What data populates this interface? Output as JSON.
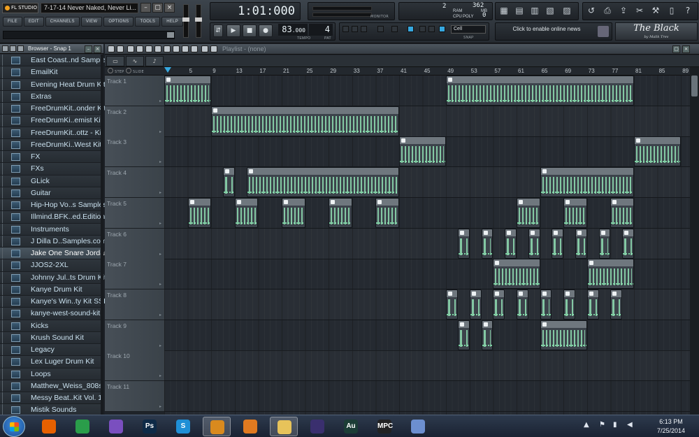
{
  "window": {
    "app_logo": "FL STUDIO",
    "song_title": "7-17-14 Never Naked, Never Li..."
  },
  "menu": [
    "FILE",
    "EDIT",
    "CHANNELS",
    "VIEW",
    "OPTIONS",
    "TOOLS",
    "HELP"
  ],
  "transport": {
    "song_position": "1:01:000",
    "tempo_main": "83",
    "tempo_frac": ".000",
    "tempo_label": "TEMPO",
    "pattern": "4",
    "pattern_label": "PAT"
  },
  "monitor": {
    "label": "MONITOR"
  },
  "performance": {
    "ram_value": "2",
    "ram_label": "RAM",
    "mb_value": "362",
    "mb_label": "MB",
    "cpu_label": "CPU",
    "poly_label": "POLY",
    "poly_value": "0"
  },
  "snap": {
    "value": "Cell",
    "label": "SNAP"
  },
  "news": {
    "text": "Click to enable online news"
  },
  "brand": {
    "name": "The Black",
    "sub": "by Malik Trev"
  },
  "browser": {
    "title": "Browser - Snap 1",
    "selected_index": 16,
    "folders": [
      "East Coast..nd Samples",
      "EmailKit",
      "Evening Heat Drum Kit",
      "Extras",
      "FreeDrumKit..onder Kit",
      "FreeDrumKi..emist  Kit",
      "FreeDrumKit..ottz - Kit",
      "FreeDrumKi..West Kit",
      "FX",
      "FXs",
      "GLick",
      "Guitar",
      "Hip-Hop Vo..s Samples",
      "Illmind.BFK..ed.Edition",
      "Instruments",
      "J Dilla D..Samples.com",
      "Jake One Snare Jordan",
      "JJOS2-2XL",
      "Johnny Jul..ts Drum Kit",
      "Kanye Drum Kit",
      "Kanye's Win..ty Kit SSL",
      "kanye-west-sound-kit",
      "Kicks",
      "Krush Sound Kit",
      "Legacy",
      "Lex Luger Drum Kit",
      "Loops",
      "Matthew_Weiss_808s",
      "Messy Beat..Kit Vol. 1",
      "Mistik Sounds"
    ]
  },
  "playlist": {
    "title": "Playlist - (none)",
    "step_label": "STEP",
    "slide_label": "SLIDE",
    "ruler_ticks": [
      "5",
      "9",
      "13",
      "17",
      "21",
      "25",
      "29",
      "33",
      "37",
      "41",
      "45",
      "49",
      "53",
      "57",
      "61",
      "65",
      "69",
      "73",
      "77",
      "81",
      "85",
      "89"
    ],
    "tracks": [
      "Track 1",
      "Track 2",
      "Track 3",
      "Track 4",
      "Track 5",
      "Track 6",
      "Track 7",
      "Track 8",
      "Track 9",
      "Track 10",
      "Track 11"
    ],
    "clips": [
      {
        "track": 0,
        "bars": [
          1,
          9
        ]
      },
      {
        "track": 0,
        "bars": [
          49,
          81
        ]
      },
      {
        "track": 1,
        "bars": [
          9,
          41
        ]
      },
      {
        "track": 2,
        "bars": [
          41,
          49
        ]
      },
      {
        "track": 2,
        "bars": [
          81,
          89
        ]
      },
      {
        "track": 3,
        "bars": [
          11,
          13
        ]
      },
      {
        "track": 3,
        "bars": [
          15,
          41
        ]
      },
      {
        "track": 3,
        "bars": [
          65,
          81
        ]
      },
      {
        "track": 4,
        "bars": [
          5,
          9
        ]
      },
      {
        "track": 4,
        "bars": [
          13,
          17
        ]
      },
      {
        "track": 4,
        "bars": [
          21,
          25
        ]
      },
      {
        "track": 4,
        "bars": [
          29,
          33
        ]
      },
      {
        "track": 4,
        "bars": [
          37,
          41
        ]
      },
      {
        "track": 4,
        "bars": [
          61,
          65
        ]
      },
      {
        "track": 4,
        "bars": [
          69,
          73
        ]
      },
      {
        "track": 4,
        "bars": [
          77,
          81
        ]
      },
      {
        "track": 5,
        "bars": [
          51,
          53
        ]
      },
      {
        "track": 5,
        "bars": [
          55,
          57
        ]
      },
      {
        "track": 5,
        "bars": [
          59,
          61
        ]
      },
      {
        "track": 5,
        "bars": [
          63,
          65
        ]
      },
      {
        "track": 5,
        "bars": [
          67,
          69
        ]
      },
      {
        "track": 5,
        "bars": [
          71,
          73
        ]
      },
      {
        "track": 5,
        "bars": [
          75,
          77
        ]
      },
      {
        "track": 5,
        "bars": [
          79,
          81
        ]
      },
      {
        "track": 6,
        "bars": [
          57,
          65
        ]
      },
      {
        "track": 6,
        "bars": [
          73,
          81
        ]
      },
      {
        "track": 7,
        "bars": [
          49,
          51
        ]
      },
      {
        "track": 7,
        "bars": [
          53,
          55
        ]
      },
      {
        "track": 7,
        "bars": [
          57,
          59
        ]
      },
      {
        "track": 7,
        "bars": [
          61,
          63
        ]
      },
      {
        "track": 7,
        "bars": [
          65,
          67
        ]
      },
      {
        "track": 7,
        "bars": [
          69,
          71
        ]
      },
      {
        "track": 7,
        "bars": [
          73,
          75
        ]
      },
      {
        "track": 7,
        "bars": [
          77,
          79
        ]
      },
      {
        "track": 8,
        "bars": [
          51,
          53
        ]
      },
      {
        "track": 8,
        "bars": [
          55,
          57
        ]
      },
      {
        "track": 8,
        "bars": [
          65,
          73
        ]
      }
    ]
  },
  "taskbar": {
    "apps": [
      {
        "name": "firefox-icon",
        "label": "",
        "color": "#e66000"
      },
      {
        "name": "chrome-icon",
        "label": "",
        "color": "#2a9d4a"
      },
      {
        "name": "media-app-icon",
        "label": "",
        "color": "#7a4fbf"
      },
      {
        "name": "photoshop-icon",
        "label": "Ps",
        "color": "#0e2a47"
      },
      {
        "name": "skype-icon",
        "label": "S",
        "color": "#1f8fd6"
      },
      {
        "name": "fl-studio-icon",
        "label": "",
        "color": "#d98a1e"
      },
      {
        "name": "media-player-icon",
        "label": "",
        "color": "#e07a20"
      },
      {
        "name": "explorer-folder-icon",
        "label": "",
        "color": "#e7c35a"
      },
      {
        "name": "pro-tools-icon",
        "label": "",
        "color": "#3a2f6e"
      },
      {
        "name": "audition-icon",
        "label": "Au",
        "color": "#1c3d36"
      },
      {
        "name": "mpc-icon",
        "label": "MPC",
        "color": "#222222"
      },
      {
        "name": "paint-icon",
        "label": "",
        "color": "#6c8fd0"
      }
    ],
    "time": "6:13 PM",
    "date": "7/25/2014"
  },
  "colors": {
    "accent": "#36a8e0",
    "note_green": "#8fe0b2"
  }
}
